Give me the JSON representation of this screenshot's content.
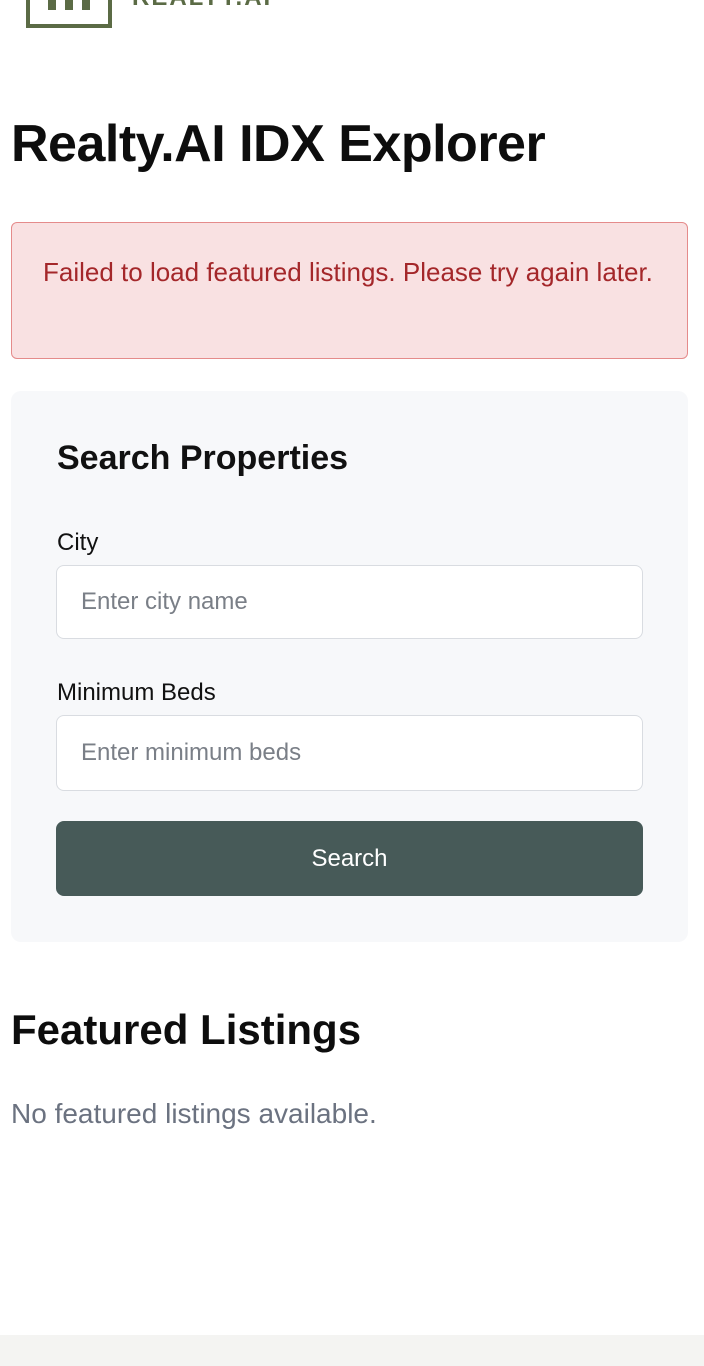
{
  "header": {
    "logo_icon": "building-logo-icon",
    "logo_text": "REALTY.AI"
  },
  "page_title": "Realty.AI IDX Explorer",
  "error_alert": {
    "message": "Failed to load featured listings. Please try again later.",
    "colors": {
      "background": "#f9e1e2",
      "border": "#e58b8b",
      "text": "#a4272a"
    }
  },
  "search": {
    "title": "Search Properties",
    "city": {
      "label": "City",
      "value": "",
      "placeholder": "Enter city name"
    },
    "min_beds": {
      "label": "Minimum Beds",
      "value": "",
      "placeholder": "Enter minimum beds"
    },
    "button_label": "Search",
    "button_color": "#475a58"
  },
  "featured": {
    "title": "Featured Listings",
    "empty_message": "No featured listings available."
  }
}
